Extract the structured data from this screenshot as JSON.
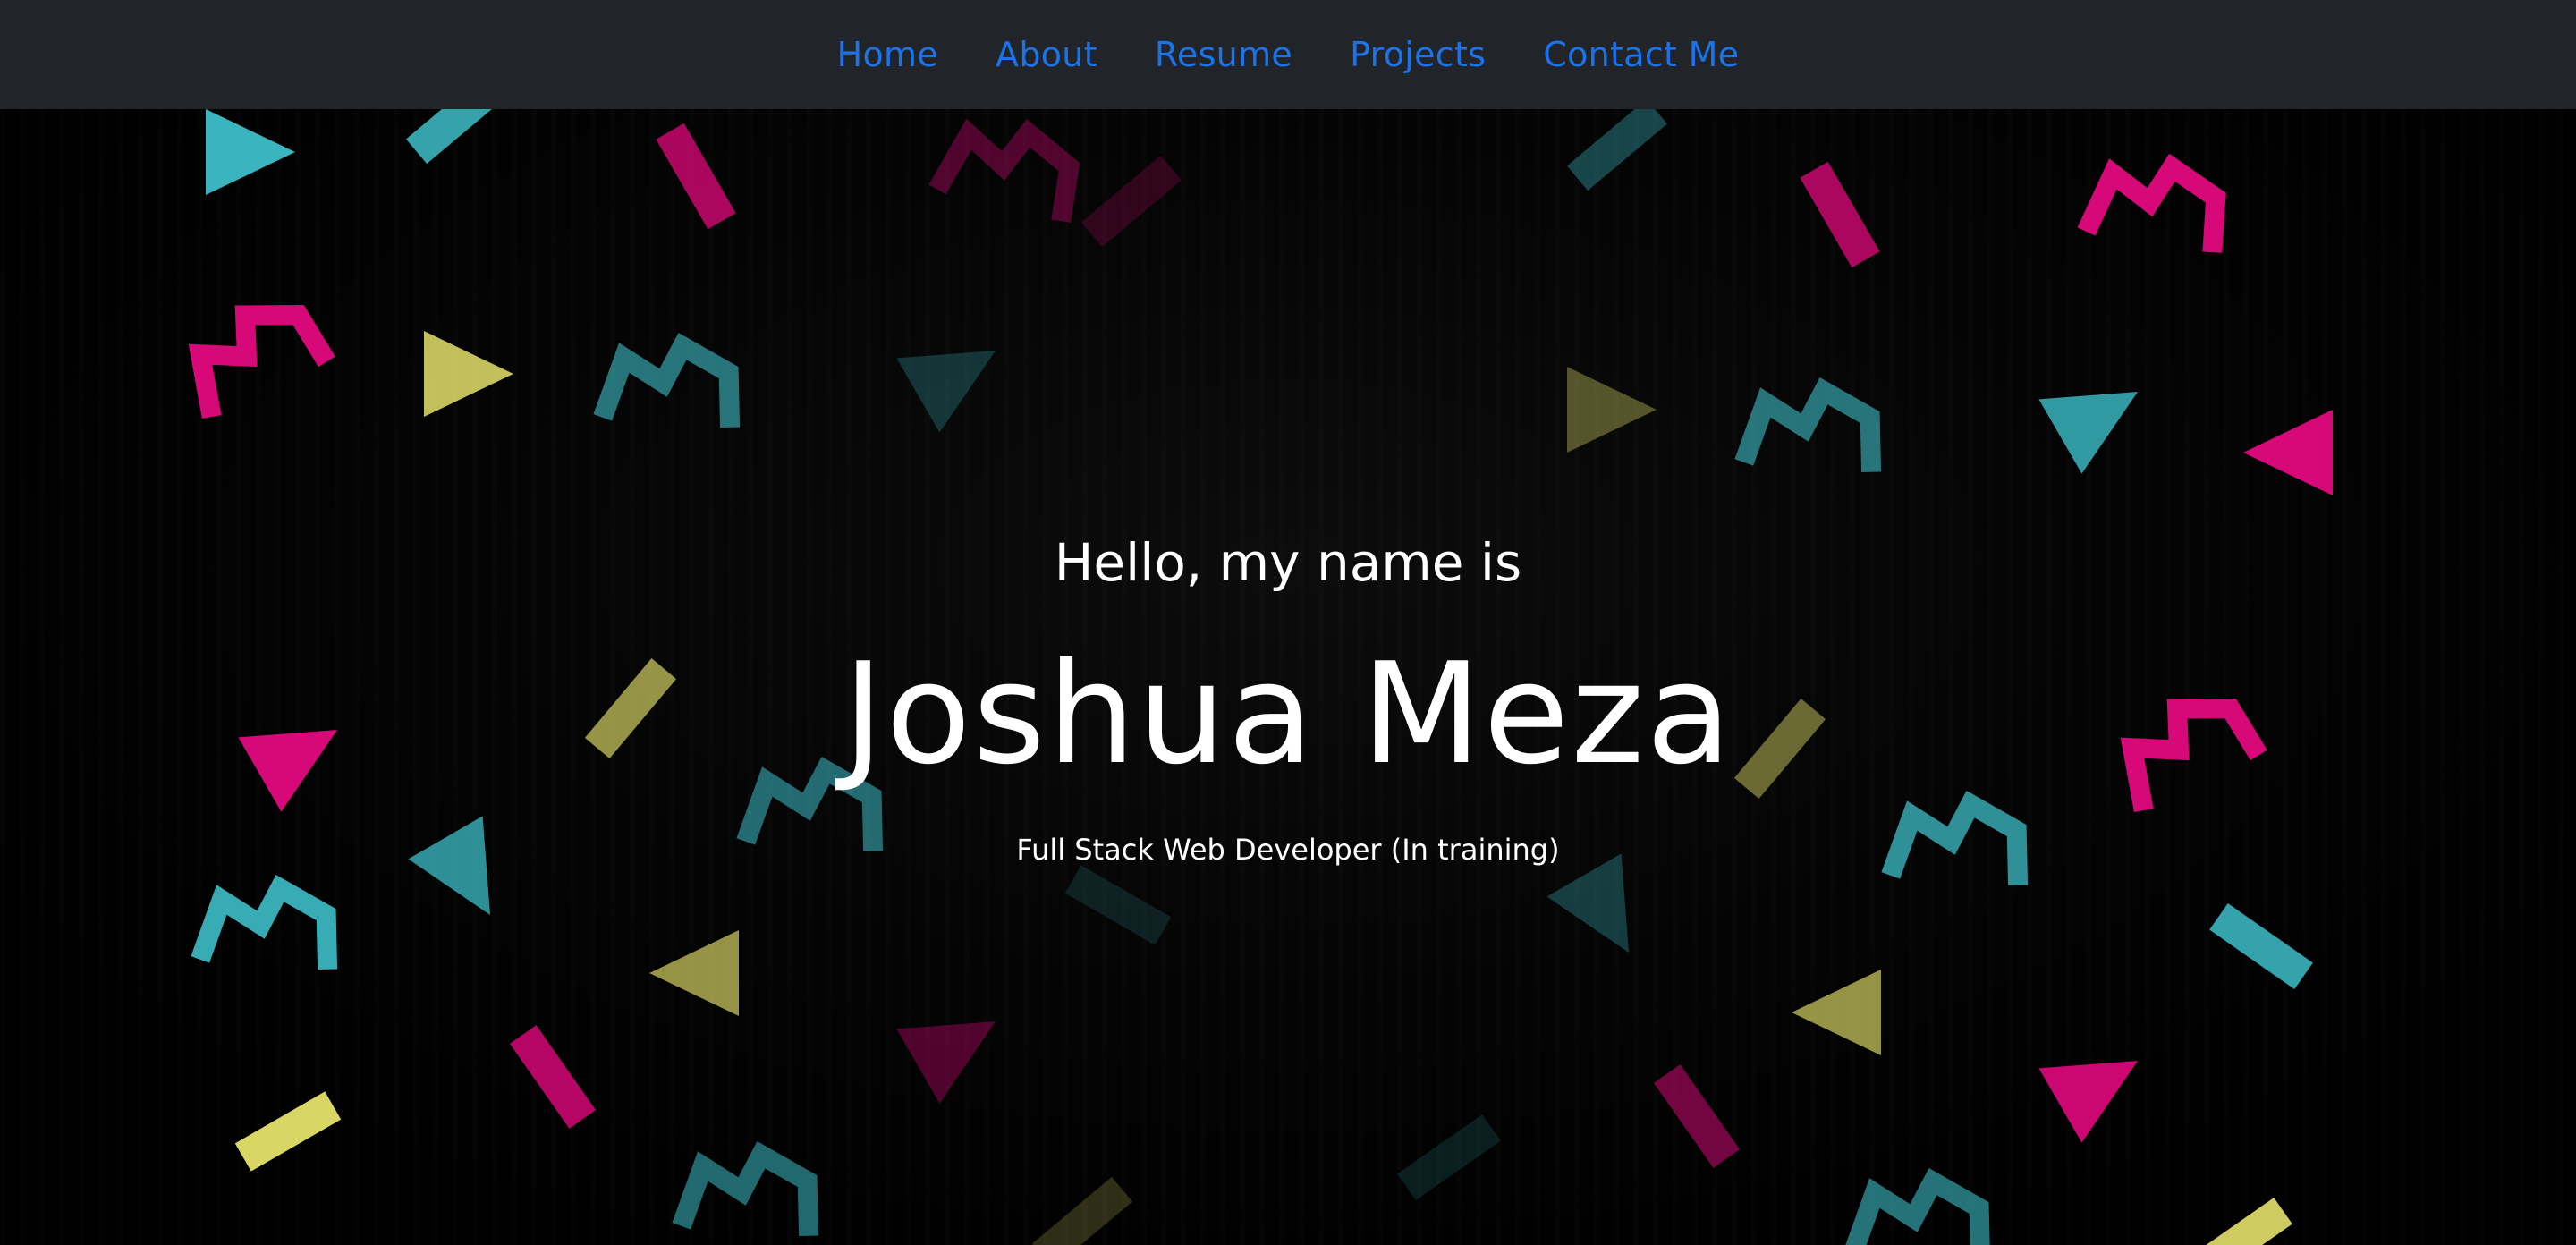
{
  "nav": {
    "items": [
      {
        "label": "Home"
      },
      {
        "label": "About"
      },
      {
        "label": "Resume"
      },
      {
        "label": "Projects"
      },
      {
        "label": "Contact Me"
      }
    ],
    "link_color": "#1a73e8",
    "bar_color": "#212428"
  },
  "hero": {
    "greeting": "Hello, my name is",
    "name": "Joshua Meza",
    "tagline": "Full Stack Web Developer (In training)",
    "background_color": "#000000",
    "confetti_colors": {
      "cyan": "#3dbfc9",
      "magenta": "#e3087e",
      "yellow": "#e4e26a"
    }
  }
}
